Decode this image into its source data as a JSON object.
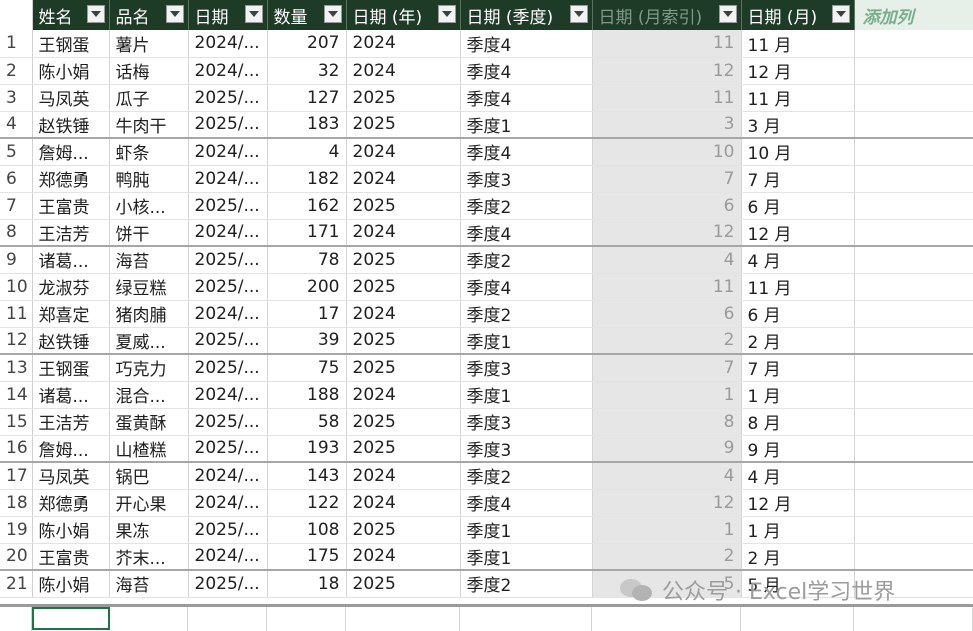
{
  "columns": [
    {
      "key": "rn",
      "label": "",
      "width": 32
    },
    {
      "key": "name",
      "label": "姓名",
      "width": 77
    },
    {
      "key": "product",
      "label": "品名",
      "width": 79
    },
    {
      "key": "date",
      "label": "日期",
      "width": 79
    },
    {
      "key": "qty",
      "label": "数量",
      "width": 79
    },
    {
      "key": "year",
      "label": "日期 (年)",
      "width": 114
    },
    {
      "key": "quarter",
      "label": "日期 (季度)",
      "width": 132
    },
    {
      "key": "month_index",
      "label": "日期 (月索引)",
      "width": 149
    },
    {
      "key": "month",
      "label": "日期 (月)",
      "width": 113
    },
    {
      "key": "add",
      "label": "添加列",
      "width": 119
    }
  ],
  "rows": [
    {
      "rn": "1",
      "name": "王钢蛋",
      "product": "薯片",
      "date": "2024/...",
      "qty": "207",
      "year": "2024",
      "quarter": "季度4",
      "month_index": "11",
      "month": "11 月"
    },
    {
      "rn": "2",
      "name": "陈小娟",
      "product": "话梅",
      "date": "2024/...",
      "qty": "32",
      "year": "2024",
      "quarter": "季度4",
      "month_index": "12",
      "month": "12 月"
    },
    {
      "rn": "3",
      "name": "马凤英",
      "product": "瓜子",
      "date": "2025/...",
      "qty": "127",
      "year": "2025",
      "quarter": "季度4",
      "month_index": "11",
      "month": "11 月"
    },
    {
      "rn": "4",
      "name": "赵铁锤",
      "product": "牛肉干",
      "date": "2025/...",
      "qty": "183",
      "year": "2025",
      "quarter": "季度1",
      "month_index": "3",
      "month": "3 月"
    },
    {
      "rn": "5",
      "name": "詹姆...",
      "product": "虾条",
      "date": "2024/...",
      "qty": "4",
      "year": "2024",
      "quarter": "季度4",
      "month_index": "10",
      "month": "10 月"
    },
    {
      "rn": "6",
      "name": "郑德勇",
      "product": "鸭肫",
      "date": "2024/...",
      "qty": "182",
      "year": "2024",
      "quarter": "季度3",
      "month_index": "7",
      "month": "7 月"
    },
    {
      "rn": "7",
      "name": "王富贵",
      "product": "小核...",
      "date": "2025/...",
      "qty": "162",
      "year": "2025",
      "quarter": "季度2",
      "month_index": "6",
      "month": "6 月"
    },
    {
      "rn": "8",
      "name": "王洁芳",
      "product": "饼干",
      "date": "2024/...",
      "qty": "171",
      "year": "2024",
      "quarter": "季度4",
      "month_index": "12",
      "month": "12 月"
    },
    {
      "rn": "9",
      "name": "诸葛...",
      "product": "海苔",
      "date": "2025/...",
      "qty": "78",
      "year": "2025",
      "quarter": "季度2",
      "month_index": "4",
      "month": "4 月"
    },
    {
      "rn": "10",
      "name": "龙淑芬",
      "product": "绿豆糕",
      "date": "2025/...",
      "qty": "200",
      "year": "2025",
      "quarter": "季度4",
      "month_index": "11",
      "month": "11 月"
    },
    {
      "rn": "11",
      "name": "郑喜定",
      "product": "猪肉脯",
      "date": "2024/...",
      "qty": "17",
      "year": "2024",
      "quarter": "季度2",
      "month_index": "6",
      "month": "6 月"
    },
    {
      "rn": "12",
      "name": "赵铁锤",
      "product": "夏威...",
      "date": "2025/...",
      "qty": "39",
      "year": "2025",
      "quarter": "季度1",
      "month_index": "2",
      "month": "2 月"
    },
    {
      "rn": "13",
      "name": "王钢蛋",
      "product": "巧克力",
      "date": "2025/...",
      "qty": "75",
      "year": "2025",
      "quarter": "季度3",
      "month_index": "7",
      "month": "7 月"
    },
    {
      "rn": "14",
      "name": "诸葛...",
      "product": "混合...",
      "date": "2024/...",
      "qty": "188",
      "year": "2024",
      "quarter": "季度1",
      "month_index": "1",
      "month": "1 月"
    },
    {
      "rn": "15",
      "name": "王洁芳",
      "product": "蛋黄酥",
      "date": "2025/...",
      "qty": "58",
      "year": "2025",
      "quarter": "季度3",
      "month_index": "8",
      "month": "8 月"
    },
    {
      "rn": "16",
      "name": "詹姆...",
      "product": "山楂糕",
      "date": "2025/...",
      "qty": "193",
      "year": "2025",
      "quarter": "季度3",
      "month_index": "9",
      "month": "9 月"
    },
    {
      "rn": "17",
      "name": "马凤英",
      "product": "锅巴",
      "date": "2024/...",
      "qty": "143",
      "year": "2024",
      "quarter": "季度2",
      "month_index": "4",
      "month": "4 月"
    },
    {
      "rn": "18",
      "name": "郑德勇",
      "product": "开心果",
      "date": "2024/...",
      "qty": "122",
      "year": "2024",
      "quarter": "季度4",
      "month_index": "12",
      "month": "12 月"
    },
    {
      "rn": "19",
      "name": "陈小娟",
      "product": "果冻",
      "date": "2025/...",
      "qty": "108",
      "year": "2025",
      "quarter": "季度1",
      "month_index": "1",
      "month": "1 月"
    },
    {
      "rn": "20",
      "name": "王富贵",
      "product": "芥末...",
      "date": "2024/...",
      "qty": "175",
      "year": "2024",
      "quarter": "季度1",
      "month_index": "2",
      "month": "2 月"
    },
    {
      "rn": "21",
      "name": "陈小娟",
      "product": "海苔",
      "date": "2025/...",
      "qty": "18",
      "year": "2025",
      "quarter": "季度2",
      "month_index": "5",
      "month": "5 月"
    }
  ],
  "watermark": {
    "text": "公众号 · Excel学习世界",
    "icon": "wechat-icon"
  },
  "colors": {
    "header_bg": "#1d3b27",
    "header_text": "#ffffff",
    "add_column_text": "#79ad8d",
    "index_column_bg": "#e6e6e6",
    "selection": "#217346"
  }
}
